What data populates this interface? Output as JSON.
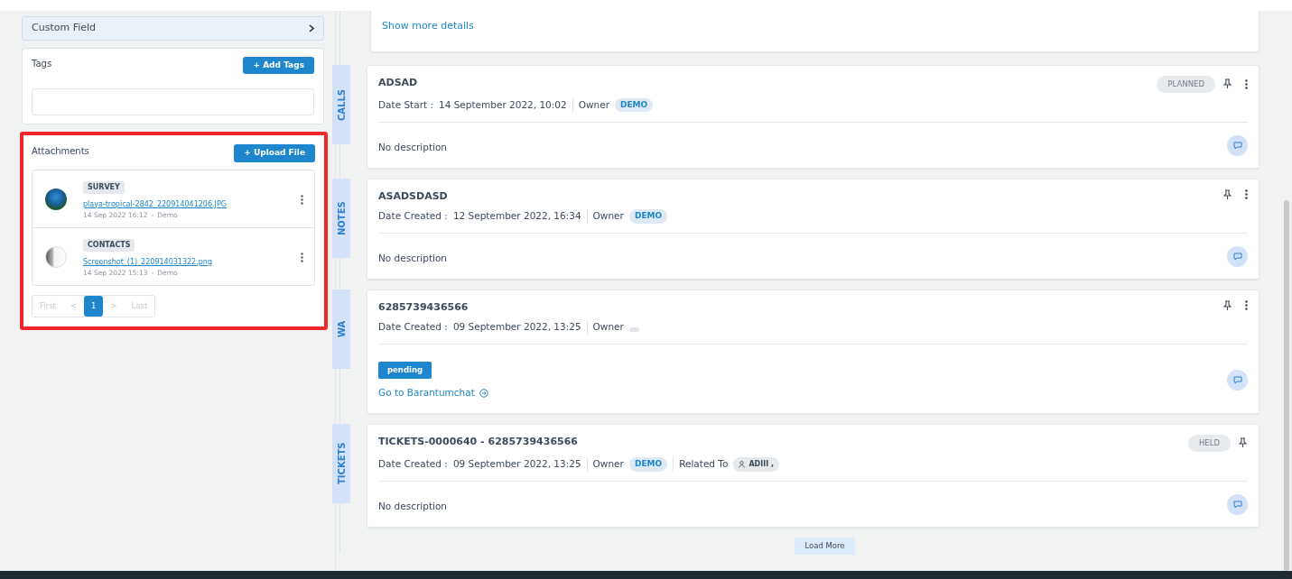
{
  "sidebar": {
    "custom_field": {
      "label": "Custom Field"
    },
    "tags": {
      "title": "Tags",
      "button": "+ Add Tags"
    },
    "attachments": {
      "title": "Attachments",
      "button": "+ Upload File",
      "highlighted": true,
      "items": [
        {
          "category": "SURVEY",
          "file": "playa-tropical-2842_220914041206.JPG",
          "date": "14 Sep 2022 16:12",
          "separator": "-",
          "user": "Demo",
          "kind": "photo"
        },
        {
          "category": "CONTACTS",
          "file": "Screenshot_(1)_220914031322.png",
          "date": "14 Sep 2022 15:13",
          "separator": "-",
          "user": "Demo",
          "kind": "screenshot"
        }
      ],
      "pagination": [
        {
          "label": "First",
          "selected": false,
          "disabled": true
        },
        {
          "label": "<",
          "selected": false,
          "disabled": true
        },
        {
          "label": "1",
          "selected": true,
          "disabled": false
        },
        {
          "label": ">",
          "selected": false,
          "disabled": true
        },
        {
          "label": "Last",
          "selected": false,
          "disabled": true
        }
      ]
    }
  },
  "timeline": {
    "top_card": {
      "link": "Show more details"
    },
    "entries": [
      {
        "type_label": "CALLS",
        "title": "ADSAD",
        "status": "PLANNED",
        "has_menu": true,
        "meta": [
          {
            "kind": "text",
            "label": "Date Start :",
            "value": "14 September 2022, 10:02"
          },
          {
            "kind": "badge",
            "label": "Owner",
            "badge": "DEMO"
          }
        ],
        "body": {
          "kind": "description",
          "text": "No description"
        }
      },
      {
        "type_label": "NOTES",
        "title": "ASADSDASD",
        "has_menu": true,
        "meta": [
          {
            "kind": "text",
            "label": "Date Created :",
            "value": "12 September 2022, 16:34"
          },
          {
            "kind": "badge",
            "label": "Owner",
            "badge": "DEMO"
          }
        ],
        "body": {
          "kind": "description",
          "text": "No description"
        }
      },
      {
        "type_label": "WA",
        "title": "6285739436566",
        "has_menu": true,
        "meta": [
          {
            "kind": "text",
            "label": "Date Created :",
            "value": "09 September 2022, 13:25"
          },
          {
            "kind": "empty_badge",
            "label": "Owner"
          }
        ],
        "body": {
          "kind": "chat",
          "status": "pending",
          "link": "Go to Barantumchat"
        }
      },
      {
        "type_label": "TICKETS",
        "title": "TICKETS-0000640 - 6285739436566",
        "status": "HELD",
        "has_menu": false,
        "meta": [
          {
            "kind": "text",
            "label": "Date Created :",
            "value": "09 September 2022, 13:25"
          },
          {
            "kind": "badge",
            "label": "Owner",
            "badge": "DEMO"
          },
          {
            "kind": "person_badge",
            "label": "Related To",
            "badge": "ADIII ,"
          }
        ],
        "body": {
          "kind": "description",
          "text": "No description"
        }
      }
    ],
    "load_more": "Load More"
  }
}
